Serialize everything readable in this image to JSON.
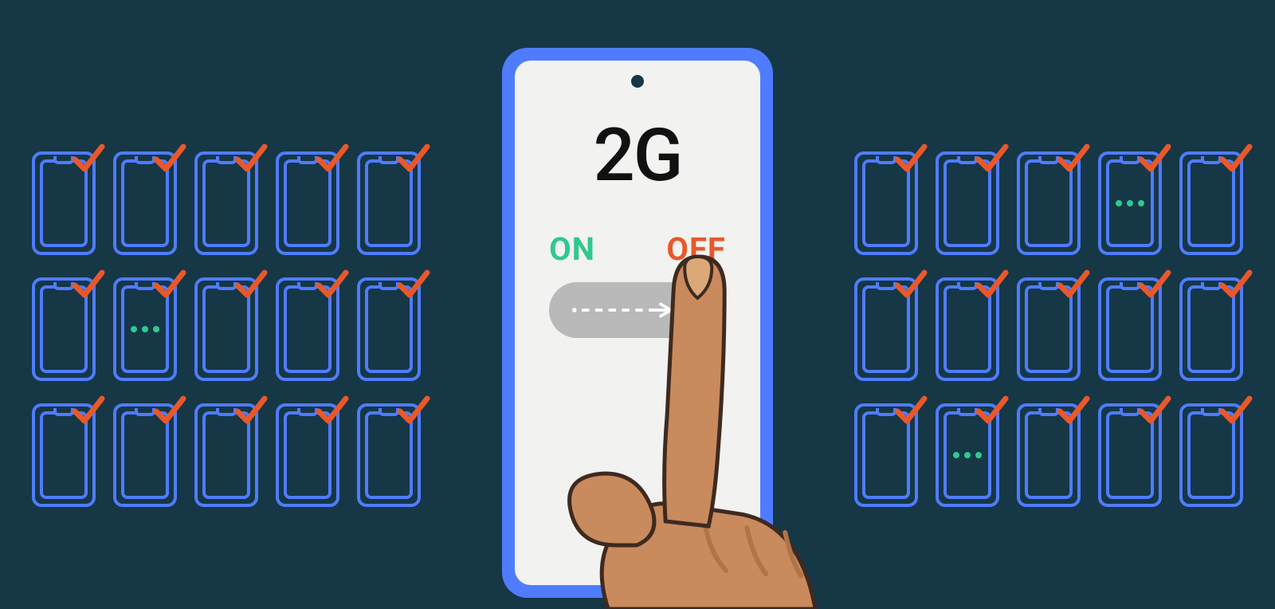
{
  "phone": {
    "title": "2G",
    "on_label": "ON",
    "off_label": "OFF",
    "toggle_state": "off"
  },
  "colors": {
    "background": "#163746",
    "phone_blue": "#4f7cff",
    "check_orange": "#e8582b",
    "on_green": "#2fc98f",
    "off_orange": "#e8582b",
    "skin": "#c98a5e",
    "skin_shadow": "#b07447"
  },
  "left_grid": {
    "rows": 3,
    "cols": 5,
    "has_dots_at": [
      [
        1,
        1
      ]
    ]
  },
  "right_grid": {
    "rows": 3,
    "cols": 5,
    "has_dots_at": [
      [
        0,
        3
      ],
      [
        2,
        1
      ]
    ]
  }
}
